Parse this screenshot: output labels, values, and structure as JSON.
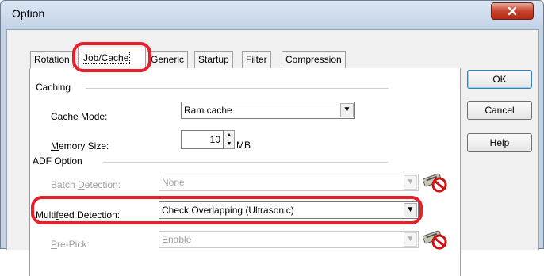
{
  "window": {
    "title": "Option"
  },
  "tabs": [
    {
      "label": "Rotation",
      "active": false
    },
    {
      "label": "Job/Cache",
      "active": true
    },
    {
      "label": "Generic",
      "active": false
    },
    {
      "label": "Startup",
      "active": false
    },
    {
      "label": "Filter",
      "active": false
    },
    {
      "label": "Compression",
      "active": false
    }
  ],
  "buttons": {
    "ok": "OK",
    "cancel": "Cancel",
    "help": "Help"
  },
  "caching": {
    "group_label": "Caching",
    "cache_mode_label_pre": "",
    "cache_mode_label_ul": "C",
    "cache_mode_label_post": "ache Mode:",
    "cache_mode_value": "Ram cache",
    "memory_label_ul": "M",
    "memory_label_post": "emory Size:",
    "memory_value": "10",
    "memory_unit": "MB"
  },
  "adf": {
    "group_label": "ADF Option",
    "batch_label_pre": "Batch ",
    "batch_label_ul": "D",
    "batch_label_post": "etection:",
    "batch_value": "None",
    "multifeed_label_pre": "Multi",
    "multifeed_label_ul": "f",
    "multifeed_label_post": "eed Detection:",
    "multifeed_value": "Check Overlapping (Ultrasonic)",
    "prepick_label_ul": "P",
    "prepick_label_post": "re-Pick:",
    "prepick_value": "Enable"
  },
  "colors": {
    "highlight": "#e8202a",
    "disabled_text": "#a0a0a0"
  }
}
